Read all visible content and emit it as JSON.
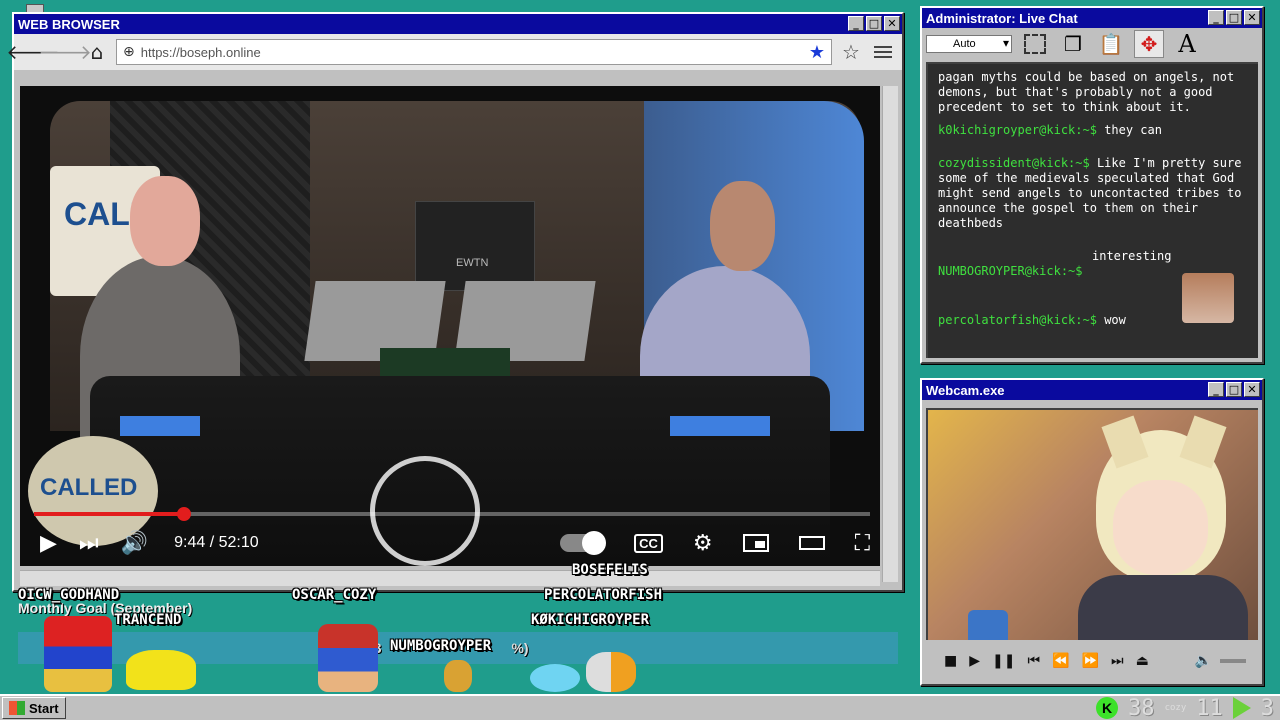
{
  "browser": {
    "title": "WEB BROWSER",
    "url": "https://boseph.online",
    "video": {
      "time": "9:44 / 52:10",
      "progress": 0.18,
      "cc_label": "CC",
      "sign_text": "CALLED",
      "badge_text": "CALLED",
      "studio_text": "EWTN"
    }
  },
  "chat": {
    "title": "Administrator: Live Chat",
    "font_select": "Auto",
    "messages": [
      {
        "user": "",
        "text": "pagan myths could be based on angels, not demons, but that's probably not a good precedent to set to think about it."
      },
      {
        "user": "k0kichigroyper@kick:~$",
        "text": "they can"
      },
      {
        "user": "cozydissident@kick:~$",
        "text": "Like I'm pretty sure some of the medievals speculated that God might send angels to uncontacted tribes to announce the gospel to them on their deathbeds"
      },
      {
        "user": "NUMBOGROYPER@kick:~$",
        "text": "interesting"
      },
      {
        "user": "percolatorfish@kick:~$",
        "text": "wow"
      }
    ]
  },
  "webcam": {
    "title": "Webcam.exe"
  },
  "overlay": {
    "goal_label": "Monthly Goal (September)",
    "goal_amount": "$3",
    "goal_percent": "%)",
    "names": {
      "n1": "OICW_GODHAND",
      "n2": "TRANCEND",
      "n3": "OSCAR_COZY",
      "n4": "NUMBOGROYPER",
      "n5": "BOSEFELIS",
      "n6": "PERCOLATORFISH",
      "n7": "KØKICHIGROYPER"
    }
  },
  "taskbar": {
    "start_label": "Start",
    "kick_count": "38",
    "cozy_label": "cozy",
    "cozy_count": "11",
    "rumble_count": "3"
  },
  "colors": {
    "desktop": "#1f9d8c",
    "titlebar": "#0a0a9e",
    "chat_user": "#3fe03f",
    "progress": "#e21d1d",
    "kick": "#3de12a"
  }
}
